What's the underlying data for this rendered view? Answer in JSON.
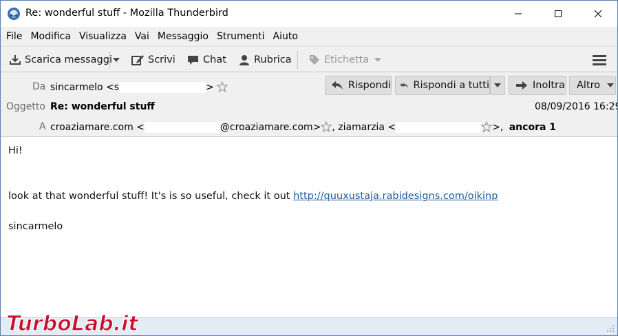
{
  "window": {
    "title": "Re: wonderful stuff - Mozilla Thunderbird"
  },
  "menu": {
    "items": [
      "File",
      "Modifica",
      "Visualizza",
      "Vai",
      "Messaggio",
      "Strumenti",
      "Aiuto"
    ]
  },
  "toolbar": {
    "get_messages_label": "Scarica messaggi",
    "write_label": "Scrivi",
    "chat_label": "Chat",
    "address_book_label": "Rubrica",
    "tag_label": "Etichetta"
  },
  "header": {
    "from_label": "Da",
    "from_name": "sincarmelo <s",
    "from_suffix": ">",
    "subject_label": "Oggetto",
    "subject": "Re: wonderful stuff",
    "date": "08/09/2016 16:29",
    "to_label": "A",
    "to_1_name": "croaziamare.com <",
    "to_1_domain": "@croaziamare.com>",
    "to_2_name": ", ziamarzia <",
    "to_2_suffix": ">,",
    "more_recipients": "ancora 1",
    "reply_label": "Rispondi",
    "reply_all_label": "Rispondi a tutti",
    "forward_label": "Inoltra",
    "other_label": "Altro"
  },
  "body": {
    "greeting": "Hi!",
    "text": "look at that wonderful stuff! It's is so useful, check it out ",
    "link": "http://quuxustaja.rabidesigns.com/oikinp",
    "signature": "sincarmelo"
  },
  "watermark": {
    "text": "TurboLab.it"
  },
  "colors": {
    "chrome_bg": "#f0f0f0",
    "link": "#1a5a9a",
    "label_grey": "#6d6d6d",
    "statusbar_bg": "#e3ecf5",
    "watermark_red": "#c8102e"
  }
}
